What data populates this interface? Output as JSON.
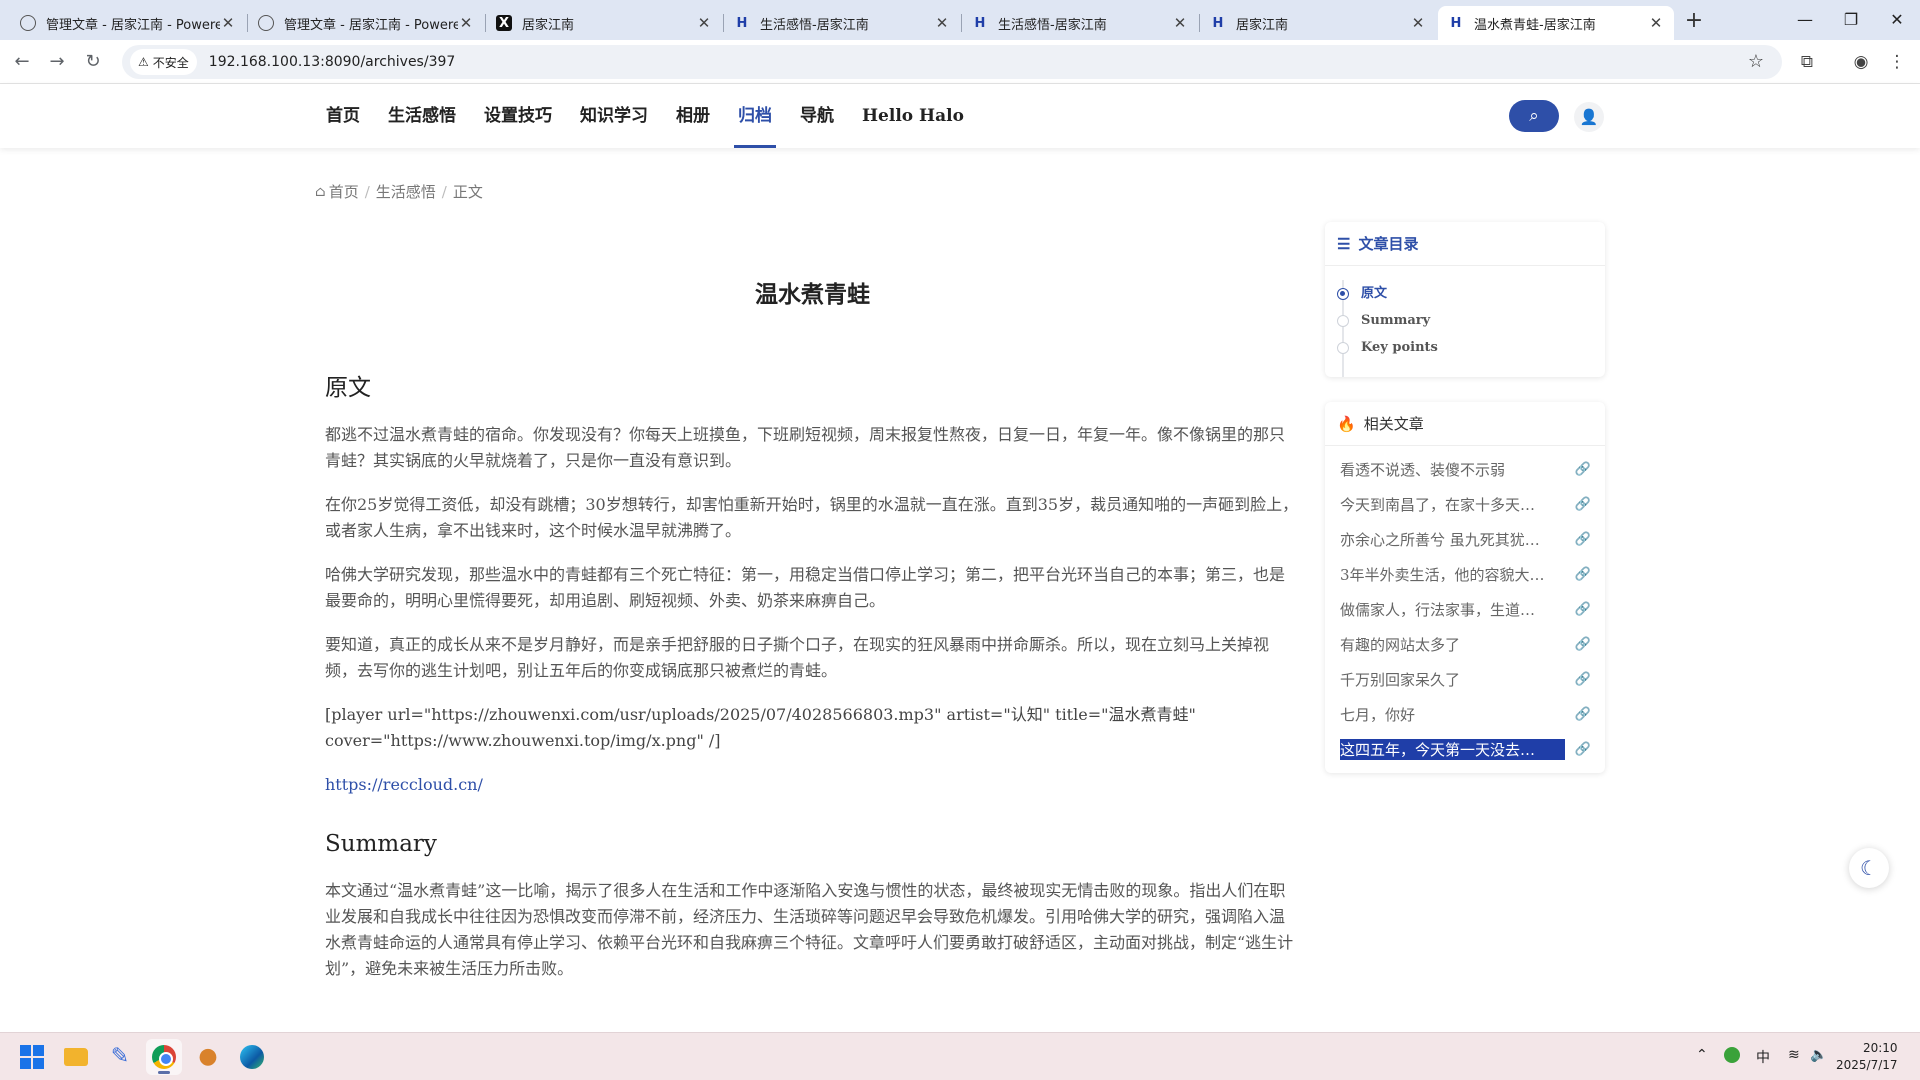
{
  "browser": {
    "tabs": [
      {
        "title": "管理文章 - 居家江南 - Powered",
        "icon": "globe-icon",
        "active": false
      },
      {
        "title": "管理文章 - 居家江南 - Powered",
        "icon": "globe-icon",
        "active": false
      },
      {
        "title": "居家江南",
        "icon": "x-icon",
        "active": false
      },
      {
        "title": "生活感悟-居家江南",
        "icon": "h-icon",
        "active": false
      },
      {
        "title": "生活感悟-居家江南",
        "icon": "h-icon",
        "active": false
      },
      {
        "title": "居家江南",
        "icon": "h-icon",
        "active": false
      },
      {
        "title": "温水煮青蛙-居家江南",
        "icon": "h-icon",
        "active": true
      }
    ],
    "security_label": "不安全",
    "url": "192.168.100.13:8090/archives/397"
  },
  "site": {
    "nav": [
      "首页",
      "生活感悟",
      "设置技巧",
      "知识学习",
      "相册",
      "归档",
      "导航",
      "Hello Halo"
    ],
    "active_nav": "归档"
  },
  "breadcrumb": {
    "home": "首页",
    "category": "生活感悟",
    "current": "正文",
    "separator": "/"
  },
  "article": {
    "title": "温水煮青蛙",
    "section1_heading": "原文",
    "paragraphs": [
      "都逃不过温水煮青蛙的宿命。你发现没有？你每天上班摸鱼，下班刷短视频，周末报复性熬夜，日复一日，年复一年。像不像锅里的那只青蛙？其实锅底的火早就烧着了，只是你一直没有意识到。",
      "在你25岁觉得工资低，却没有跳槽；30岁想转行，却害怕重新开始时，锅里的水温就一直在涨。直到35岁，裁员通知啪的一声砸到脸上，或者家人生病，拿不出钱来时，这个时候水温早就沸腾了。",
      "哈佛大学研究发现，那些温水中的青蛙都有三个死亡特征：第一，用稳定当借口停止学习；第二，把平台光环当自己的本事；第三，也是最要命的，明明心里慌得要死，却用追剧、刷短视频、外卖、奶茶来麻痹自己。",
      "要知道，真正的成长从来不是岁月静好，而是亲手把舒服的日子撕个口子，在现实的狂风暴雨中拼命厮杀。所以，现在立刻马上关掉视频，去写你的逃生计划吧，别让五年后的你变成锅底那只被煮烂的青蛙。"
    ],
    "player_shortcode": "[player url=\"https://zhouwenxi.com/usr/uploads/2025/07/4028566803.mp3\" artist=\"认知\" title=\"温水煮青蛙\" cover=\"https://www.zhouwenxi.top/img/x.png\" /]",
    "link": "https://reccloud.cn/",
    "summary_heading": "Summary",
    "summary": "本文通过“温水煮青蛙”这一比喻，揭示了很多人在生活和工作中逐渐陷入安逸与惯性的状态，最终被现实无情击败的现象。指出人们在职业发展和自我成长中往往因为恐惧改变而停滞不前，经济压力、生活琐碎等问题迟早会导致危机爆发。引用哈佛大学的研究，强调陷入温水煮青蛙命运的人通常具有停止学习、依赖平台光环和自我麻痹三个特征。文章呼吁人们要勇敢打破舒适区，主动面对挑战，制定“逃生计划”，避免未来被生活压力所击败。"
  },
  "toc": {
    "title": "文章目录",
    "items": [
      "原文",
      "Summary",
      "Key points"
    ],
    "active_index": 0
  },
  "related": {
    "title": "相关文章",
    "items": [
      "看透不说透、装傻不示弱",
      "今天到南昌了，在家十多天…",
      "亦余心之所善兮 虽九死其犹…",
      "3年半外卖生活，他的容貌大…",
      "做儒家人，行法家事，生道…",
      "有趣的网站太多了",
      "千万别回家呆久了",
      "七月，你好",
      "这四五年，今天第一天没去…"
    ],
    "selected_index": 8
  },
  "taskbar": {
    "ime": "中",
    "time": "20:10",
    "date": "2025/7/17"
  },
  "colors": {
    "accent": "#2e4fa8",
    "selection": "#1f3ea8",
    "taskbar": "#f3e6e8"
  }
}
